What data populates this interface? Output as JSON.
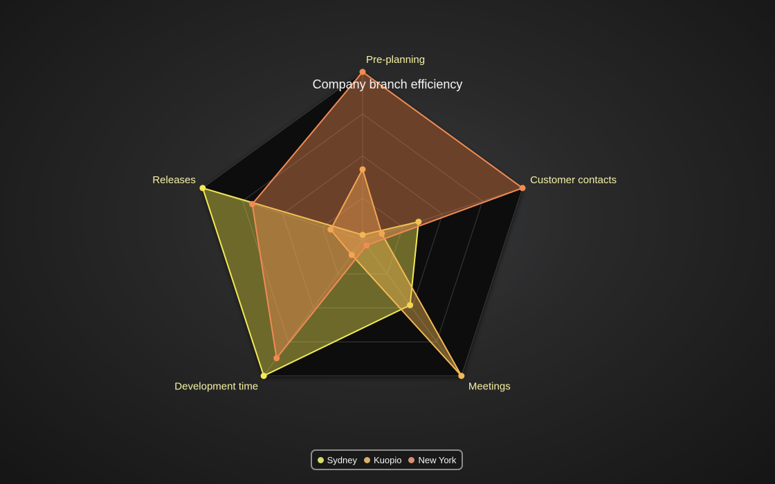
{
  "chart_data": {
    "type": "radar",
    "title": "Company branch efficiency",
    "axes": [
      "Pre-planning",
      "Customer contacts",
      "Meetings",
      "Development time",
      "Releases"
    ],
    "range": [
      0,
      1
    ],
    "series": [
      {
        "name": "Sydney",
        "color": "#f2ea55",
        "values": [
          0.03,
          0.35,
          0.48,
          1.0,
          1.0
        ]
      },
      {
        "name": "Kuopio",
        "color": "#f5b954",
        "values": [
          0.42,
          0.12,
          1.0,
          0.11,
          0.2
        ]
      },
      {
        "name": "New York",
        "color": "#f08b54",
        "values": [
          1.0,
          1.0,
          0.04,
          0.87,
          0.69
        ]
      }
    ]
  },
  "legend": {
    "items": [
      {
        "label": "Sydney",
        "color": "#d6dd68"
      },
      {
        "label": "Kuopio",
        "color": "#d8b06a"
      },
      {
        "label": "New York",
        "color": "#d99170"
      }
    ]
  }
}
